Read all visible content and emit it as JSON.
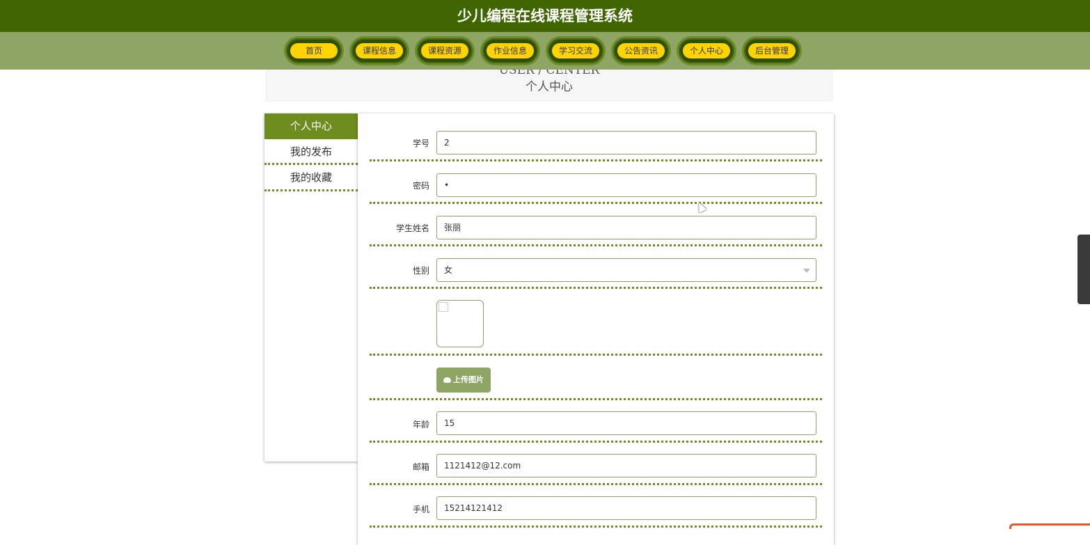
{
  "header": {
    "title": "少儿编程在线课程管理系统"
  },
  "nav": {
    "items": [
      {
        "label": "首页"
      },
      {
        "label": "课程信息"
      },
      {
        "label": "课程资源"
      },
      {
        "label": "作业信息"
      },
      {
        "label": "学习交流"
      },
      {
        "label": "公告资讯"
      },
      {
        "label": "个人中心"
      },
      {
        "label": "后台管理"
      }
    ]
  },
  "breadcrumb": {
    "en": "USER / CENTER",
    "cn": "个人中心"
  },
  "sidebar": {
    "items": [
      {
        "label": "个人中心",
        "active": true
      },
      {
        "label": "我的发布"
      },
      {
        "label": "我的收藏"
      }
    ]
  },
  "form": {
    "student_id": {
      "label": "学号",
      "value": "2"
    },
    "password": {
      "label": "密码",
      "value": "•"
    },
    "name": {
      "label": "学生姓名",
      "value": "张丽"
    },
    "gender": {
      "label": "性别",
      "value": "女"
    },
    "upload": {
      "label": "上传图片"
    },
    "age": {
      "label": "年龄",
      "value": "15"
    },
    "email": {
      "label": "邮箱",
      "value": "1121412@12.com"
    },
    "phone": {
      "label": "手机",
      "value": "15214121412"
    }
  },
  "colors": {
    "header_bg": "#3f6600",
    "nav_bg": "#8ea564",
    "accent": "#6f8c1e",
    "pill": "#ffd400"
  }
}
